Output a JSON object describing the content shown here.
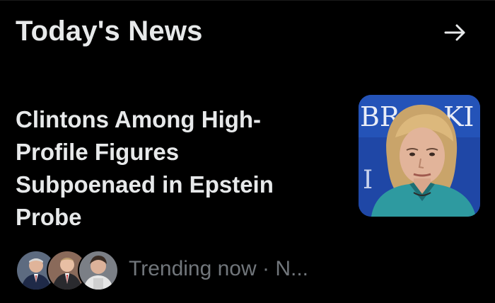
{
  "header": {
    "title": "Today's News",
    "arrow_icon": "arrow-right-icon"
  },
  "story": {
    "headline_lines": [
      "Clintons Among High-",
      "Profile Figures",
      "Subpoenaed in Epstein",
      "Probe"
    ],
    "thumbnail_sign_text_left": "BR",
    "thumbnail_sign_text_right": "KI",
    "thumbnail_sign_text_lower": "I",
    "meta_text": "Trending now · N..."
  },
  "colors": {
    "background": "#000000",
    "text_primary": "#e7e9ea",
    "text_secondary": "#71767b",
    "thumbnail_blue": "#1c3d8f"
  }
}
